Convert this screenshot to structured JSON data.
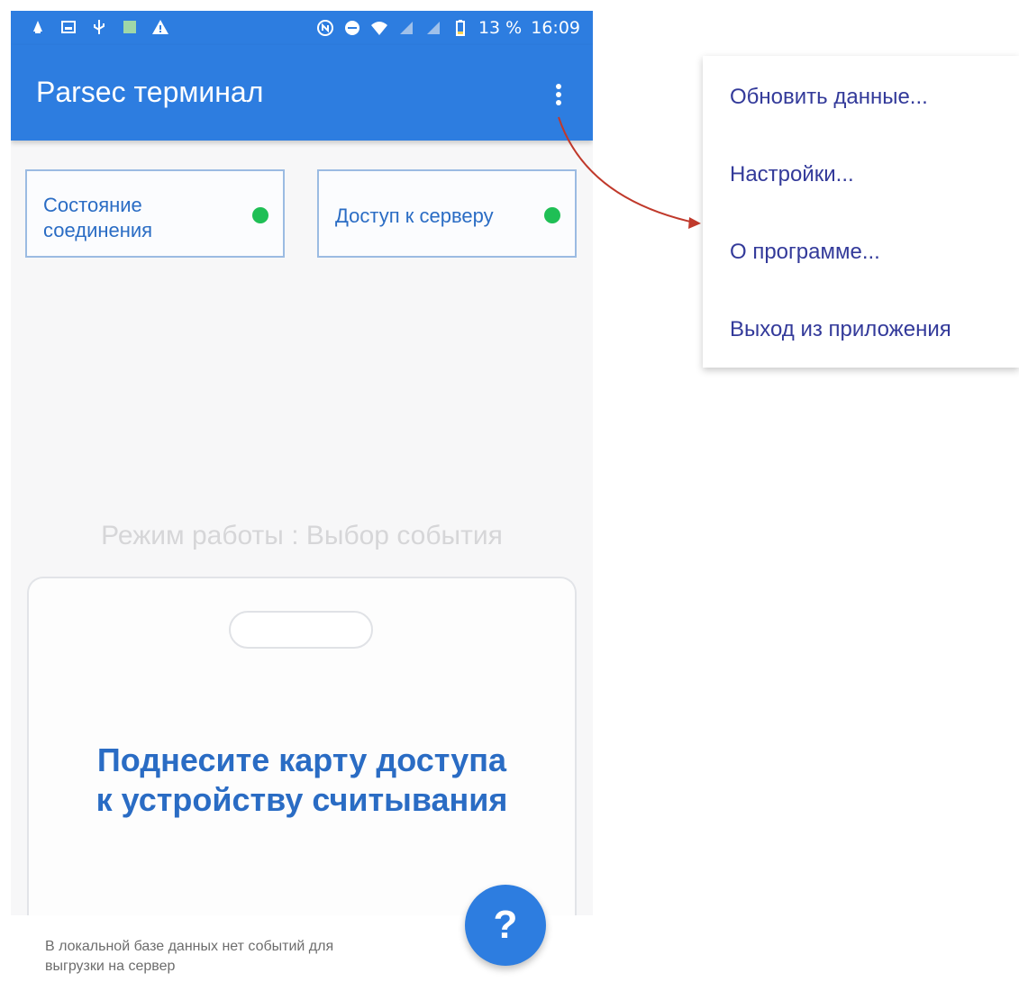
{
  "statusbar": {
    "battery": "13 %",
    "time": "16:09",
    "left_icons": [
      "notification-icon",
      "image-icon",
      "usb-icon",
      "app-icon",
      "warning-icon"
    ],
    "right_icons": [
      "nfc-icon",
      "do-not-disturb-icon",
      "wifi-icon",
      "signal-icon",
      "signal-icon",
      "battery-icon"
    ]
  },
  "appbar": {
    "title": "Parsec терминал",
    "overflow_icon": "more-vert-icon",
    "accent_color": "#2d7de0"
  },
  "cards": {
    "connection": {
      "label": "Состояние соединения",
      "status_color": "#1fbf55"
    },
    "server": {
      "label": "Доступ к серверу",
      "status_color": "#1fbf55"
    }
  },
  "mode": {
    "text": "Режим работы : Выбор события"
  },
  "badge": {
    "text_line1": "Поднесите карту доступа",
    "text_line2": "к устройству считывания"
  },
  "snackbar": {
    "text_line1": "В локальной базе данных нет событий для",
    "text_line2": "выгрузки на сервер"
  },
  "fab": {
    "label": "?"
  },
  "menu": {
    "items": [
      {
        "label": "Обновить данные..."
      },
      {
        "label": "Настройки..."
      },
      {
        "label": "О программе..."
      },
      {
        "label": "Выход из приложения"
      }
    ]
  }
}
